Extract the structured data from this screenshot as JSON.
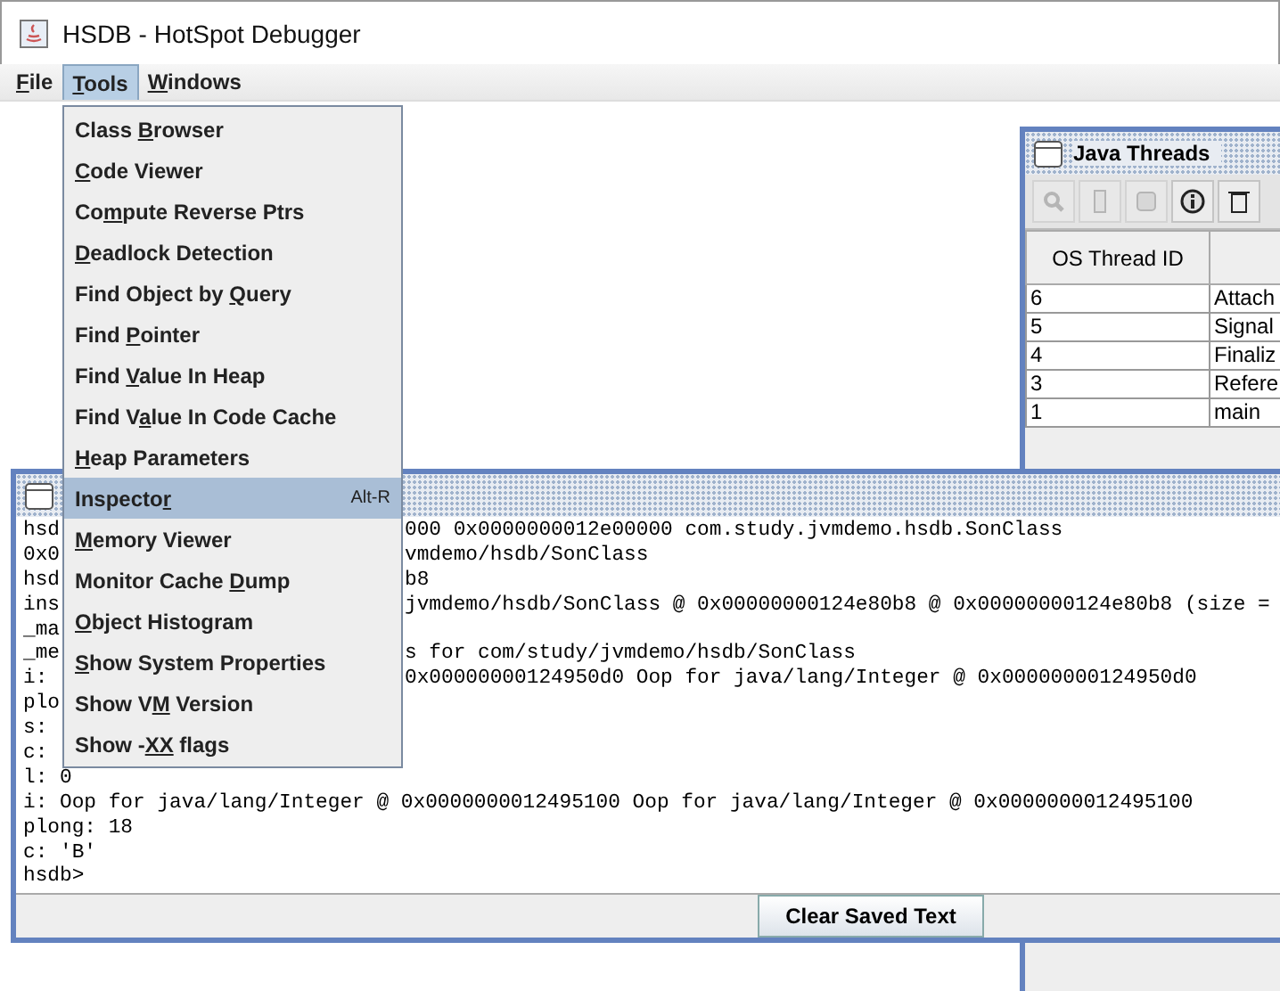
{
  "window": {
    "title": "HSDB - HotSpot Debugger"
  },
  "menu_bar": [
    {
      "label": {
        "key": "F",
        "post": "ile"
      },
      "selected": false
    },
    {
      "label": {
        "key": "T",
        "post": "ools"
      },
      "selected": true
    },
    {
      "label": {
        "key": "W",
        "post": "indows"
      },
      "selected": false
    }
  ],
  "tools_menu": [
    {
      "label": {
        "pre": "Class ",
        "key": "B",
        "post": "rowser"
      },
      "selected": false
    },
    {
      "label": {
        "key": "C",
        "post": "ode Viewer"
      },
      "selected": false
    },
    {
      "label": {
        "pre": "Co",
        "key": "m",
        "post": "pute Reverse Ptrs"
      },
      "selected": false
    },
    {
      "label": {
        "key": "D",
        "post": "eadlock Detection"
      },
      "selected": false
    },
    {
      "label": {
        "pre": "Find Object by ",
        "key": "Q",
        "post": "uery"
      },
      "selected": false
    },
    {
      "label": {
        "pre": "Find ",
        "key": "P",
        "post": "ointer"
      },
      "selected": false
    },
    {
      "label": {
        "pre": "Find ",
        "key": "V",
        "post": "alue In Heap"
      },
      "selected": false
    },
    {
      "label": {
        "pre": "Find V",
        "key": "a",
        "post": "lue In Code Cache"
      },
      "selected": false
    },
    {
      "label": {
        "key": "H",
        "post": "eap Parameters"
      },
      "selected": false
    },
    {
      "label": {
        "pre": "Inspecto",
        "key": "r"
      },
      "shortcut": "Alt-R",
      "selected": true
    },
    {
      "label": {
        "key": "M",
        "post": "emory Viewer"
      },
      "selected": false
    },
    {
      "label": {
        "pre": "Monitor Cache ",
        "key": "D",
        "post": "ump"
      },
      "selected": false
    },
    {
      "label": {
        "key": "O",
        "post": "bject Histogram"
      },
      "selected": false
    },
    {
      "label": {
        "key": "S",
        "post": "how System Properties"
      },
      "selected": false
    },
    {
      "label": {
        "pre": "Show V",
        "key": "M",
        "post": " Version"
      },
      "selected": false
    },
    {
      "label": {
        "pre": "Show -",
        "key": "XX",
        "post": " flags"
      },
      "selected": false
    }
  ],
  "java_threads": {
    "title": "Java Threads",
    "toolbar": [
      {
        "kind": "search",
        "disabled": true
      },
      {
        "kind": "page",
        "disabled": true
      },
      {
        "kind": "disk",
        "disabled": true
      },
      {
        "kind": "info",
        "disabled": false
      },
      {
        "kind": "trash",
        "disabled": false
      }
    ],
    "columns": [
      "OS Thread ID"
    ],
    "rows": [
      {
        "id": "6",
        "name": "Attach"
      },
      {
        "id": "5",
        "name": "Signal"
      },
      {
        "id": "4",
        "name": "Finaliz"
      },
      {
        "id": "3",
        "name": "Refere"
      },
      {
        "id": "1",
        "name": "main"
      }
    ]
  },
  "console": {
    "lines": [
      {
        "kind": "split",
        "left": "hsd",
        "right": "000 0x0000000012e00000 com.study.jvmdemo.hsdb.SonClass"
      },
      {
        "kind": "split",
        "left": "0x0",
        "right": "vmdemo/hsdb/SonClass"
      },
      {
        "kind": "split",
        "left": "hsd",
        "right": "b8"
      },
      {
        "kind": "split",
        "left": "ins",
        "right": "jvmdemo/hsdb/SonClass @ 0x00000000124e80b8 @ 0x00000000124e80b8 (size ="
      },
      {
        "kind": "split",
        "left": "_ma"
      },
      {
        "kind": "split",
        "left": "_me",
        "right": "s for com/study/jvmdemo/hsdb/SonClass"
      },
      {
        "kind": "split",
        "left": "i:",
        "right": "0x00000000124950d0 Oop for java/lang/Integer @ 0x00000000124950d0"
      },
      {
        "kind": "split",
        "left": "plo"
      },
      {
        "kind": "split",
        "left": "s:"
      },
      {
        "kind": "split",
        "left": "c:"
      },
      {
        "kind": "full",
        "text": "l: 0"
      },
      {
        "kind": "full",
        "text": "i: Oop for java/lang/Integer @ 0x0000000012495100 Oop for java/lang/Integer @ 0x0000000012495100"
      },
      {
        "kind": "full",
        "text": "plong: 18"
      },
      {
        "kind": "full",
        "text": "c: 'B'"
      },
      {
        "kind": "full",
        "text": "hsdb>"
      }
    ],
    "button": "Clear Saved Text"
  }
}
